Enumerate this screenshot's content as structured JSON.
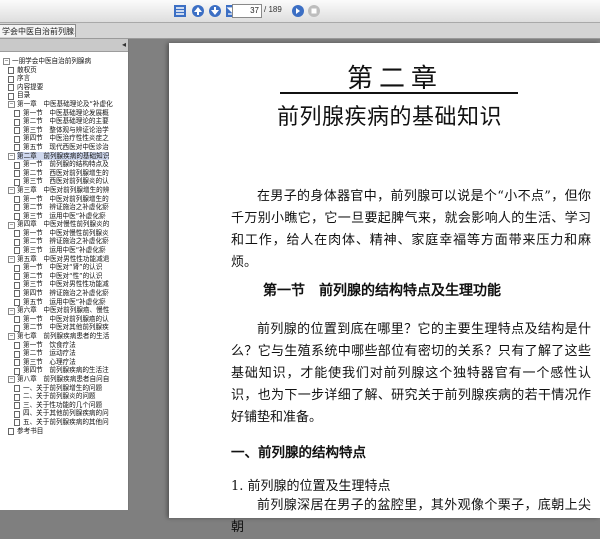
{
  "toolbar": {
    "icons": [
      "fit-page-icon",
      "page-up-icon",
      "page-down-icon",
      "last-page-icon",
      "go-icon",
      "stop-icon"
    ],
    "current_page": "37",
    "total_pages": "/ 189"
  },
  "tab": {
    "label": "学会中医自治前列腺..."
  },
  "sidebar": {
    "collapse_glyph": "◂",
    "tree": [
      {
        "text": "一朋学会中医自治前列腺病",
        "level": 0,
        "kind": "expander",
        "glyph": "−"
      },
      {
        "text": "散权页",
        "level": 1,
        "kind": "page"
      },
      {
        "text": "序言",
        "level": 1,
        "kind": "page"
      },
      {
        "text": "内容提要",
        "level": 1,
        "kind": "page"
      },
      {
        "text": "目录",
        "level": 1,
        "kind": "page"
      },
      {
        "text": "第一章　中医基础理论及“补虚化",
        "level": 1,
        "kind": "expander",
        "glyph": "−"
      },
      {
        "text": "第一节　中医基础理论发展概",
        "level": 2,
        "kind": "page"
      },
      {
        "text": "第二节　中医基础理论的主要",
        "level": 2,
        "kind": "page"
      },
      {
        "text": "第三节　整体观与辨证论治学",
        "level": 2,
        "kind": "page"
      },
      {
        "text": "第四节　中医治疗性性炎症之",
        "level": 2,
        "kind": "page"
      },
      {
        "text": "第五节　现代西医对中医诊治",
        "level": 2,
        "kind": "page"
      },
      {
        "text": "第二章　前列腺疾病的基础知识",
        "level": 1,
        "kind": "expander",
        "glyph": "−",
        "selected": true
      },
      {
        "text": "第一节　前列腺的结构特点及",
        "level": 2,
        "kind": "page"
      },
      {
        "text": "第二节　西医对前列腺增生的",
        "level": 2,
        "kind": "page"
      },
      {
        "text": "第三节　西医对前列腺炎的认",
        "level": 2,
        "kind": "page"
      },
      {
        "text": "第三章　中医对前列腺增生的辨",
        "level": 1,
        "kind": "expander",
        "glyph": "−"
      },
      {
        "text": "第一节　中医对前列腺增生的",
        "level": 2,
        "kind": "page"
      },
      {
        "text": "第二节　辨证施治之补虚化瘀",
        "level": 2,
        "kind": "page"
      },
      {
        "text": "第三节　运用中医“补虚化瘀",
        "level": 2,
        "kind": "page"
      },
      {
        "text": "第四章　中医对慢性前列腺炎的",
        "level": 1,
        "kind": "expander",
        "glyph": "−"
      },
      {
        "text": "第一节　中医对慢性前列腺炎",
        "level": 2,
        "kind": "page"
      },
      {
        "text": "第二节　辨证施治之补虚化瘀",
        "level": 2,
        "kind": "page"
      },
      {
        "text": "第三节　运用中医“补虚化瘀",
        "level": 2,
        "kind": "page"
      },
      {
        "text": "第五章　中医对男性性功能减退",
        "level": 1,
        "kind": "expander",
        "glyph": "−"
      },
      {
        "text": "第一节　中医对“肾”的认识",
        "level": 2,
        "kind": "page"
      },
      {
        "text": "第二节　中医对“性”的认识",
        "level": 2,
        "kind": "page"
      },
      {
        "text": "第三节　中医对男性性功能减",
        "level": 2,
        "kind": "page"
      },
      {
        "text": "第四节　辨证施治之补虚化瘀",
        "level": 2,
        "kind": "page"
      },
      {
        "text": "第五节　运用中医“补虚化瘀",
        "level": 2,
        "kind": "page"
      },
      {
        "text": "第六章　中医对前列腺癌、慢性",
        "level": 1,
        "kind": "expander",
        "glyph": "−"
      },
      {
        "text": "第一节　中医对前列腺癌的认",
        "level": 2,
        "kind": "page"
      },
      {
        "text": "第二节　中医对其他前列腺疾",
        "level": 2,
        "kind": "page"
      },
      {
        "text": "第七章　前列腺疾病患者的生活",
        "level": 1,
        "kind": "expander",
        "glyph": "−"
      },
      {
        "text": "第一节　饮食疗法",
        "level": 2,
        "kind": "page"
      },
      {
        "text": "第二节　运动疗法",
        "level": 2,
        "kind": "page"
      },
      {
        "text": "第三节　心理疗法",
        "level": 2,
        "kind": "page"
      },
      {
        "text": "第四节　前列腺疾病的生活注",
        "level": 2,
        "kind": "page"
      },
      {
        "text": "第八章　前列腺疾病患者自问自",
        "level": 1,
        "kind": "expander",
        "glyph": "−"
      },
      {
        "text": "一、关于前列腺增生的问题",
        "level": 2,
        "kind": "page"
      },
      {
        "text": "二、关于前列腺炎的问题",
        "level": 2,
        "kind": "page"
      },
      {
        "text": "三、关于性功能的几个问题",
        "level": 2,
        "kind": "page"
      },
      {
        "text": "四、关于其他前列腺疾病的问",
        "level": 2,
        "kind": "page"
      },
      {
        "text": "五、关于前列腺疾病的其他问",
        "level": 2,
        "kind": "page"
      },
      {
        "text": "参考书目",
        "level": 1,
        "kind": "page"
      }
    ]
  },
  "page": {
    "chapter": "第二章",
    "chapter_title": "前列腺疾病的基础知识",
    "intro": "在男子的身体器官中，前列腺可以说是个“小不点”，但你千万别小瞧它，它一旦要起脾气来，就会影响人的生活、学习和工作，给人在肉体、精神、家庭幸福等方面带来压力和麻烦。",
    "section_title": "第一节　前列腺的结构特点及生理功能",
    "section_para": "前列腺的位置到底在哪里？它的主要生理特点及结构是什么？它与生殖系统中哪些部位有密切的关系？只有了解了这些基础知识，才能使我们对前列腺这个独特器官有一个感性认识，也为下一步详细了解、研究关于前列腺疾病的若干情况作好铺垫和准备。",
    "subheading": "一、前列腺的结构特点",
    "subsubheading": "1. 前列腺的位置及生理特点",
    "last_para": "前列腺深居在男子的盆腔里，其外观像个栗子，底朝上尖朝"
  }
}
